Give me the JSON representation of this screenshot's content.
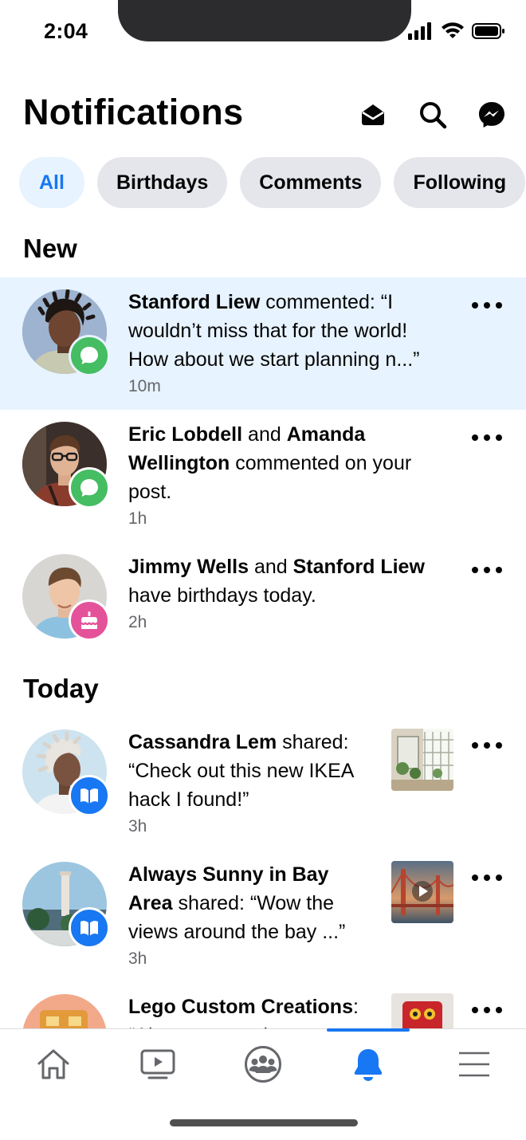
{
  "status_bar": {
    "time": "2:04"
  },
  "header": {
    "title": "Notifications",
    "icons": [
      "mark-read-icon",
      "search-icon",
      "messenger-icon"
    ]
  },
  "filters": [
    {
      "label": "All",
      "active": true
    },
    {
      "label": "Birthdays",
      "active": false
    },
    {
      "label": "Comments",
      "active": false
    },
    {
      "label": "Following",
      "active": false
    }
  ],
  "sections": {
    "new": "New",
    "today": "Today"
  },
  "notifications": [
    {
      "actor": "Stanford Liew",
      "line1_rest": " commented: “I",
      "line2": "wouldn’t miss that for the world!",
      "line3": "How about we start planning n...”",
      "time": "10m",
      "badge": "comment-icon",
      "unread": true
    },
    {
      "actor": "Eric Lobdell",
      "joiner": " and ",
      "actor2a": "Amanda",
      "actor2b": "Wellington",
      "line2_rest": " commented on your",
      "line3": "post.",
      "time": "1h",
      "badge": "comment-icon"
    },
    {
      "actor": "Jimmy Wells",
      "joiner": " and ",
      "actor2": "Stanford Liew",
      "line2": "have birthdays today.",
      "time": "2h",
      "badge": "birthday-cake-icon"
    },
    {
      "actor": "Cassandra Lem",
      "line1_rest": " shared:",
      "line2": "“Check out this new IKEA",
      "line3": "hack I found!”",
      "time": "3h",
      "badge": "shared-page-icon",
      "thumbnail": "greenhouse-photo"
    },
    {
      "actor_a": "Always Sunny in Bay",
      "actor_b": "Area",
      "line2_rest": " shared: “Wow the",
      "line3": "views around the bay ...”",
      "time": "3h",
      "badge": "shared-page-icon",
      "thumbnail": "golden-gate-video"
    },
    {
      "actor": "Lego Custom Creations",
      "line1_rest": ":",
      "line2": "“Always wanted to ...",
      "badge": "shared-page-icon",
      "thumbnail": "lego-robot-photo"
    }
  ],
  "bottom_nav": {
    "items": [
      "home-icon",
      "watch-icon",
      "groups-icon",
      "notifications-bell-icon",
      "menu-icon"
    ],
    "active": "notifications-bell-icon"
  },
  "colors": {
    "accent": "#1877f2",
    "unread_bg": "#e7f3ff",
    "comment_badge": "#45bd62",
    "birthday_badge": "#e4529a",
    "chip_bg": "#e4e6eb",
    "secondary_text": "#65676b"
  }
}
